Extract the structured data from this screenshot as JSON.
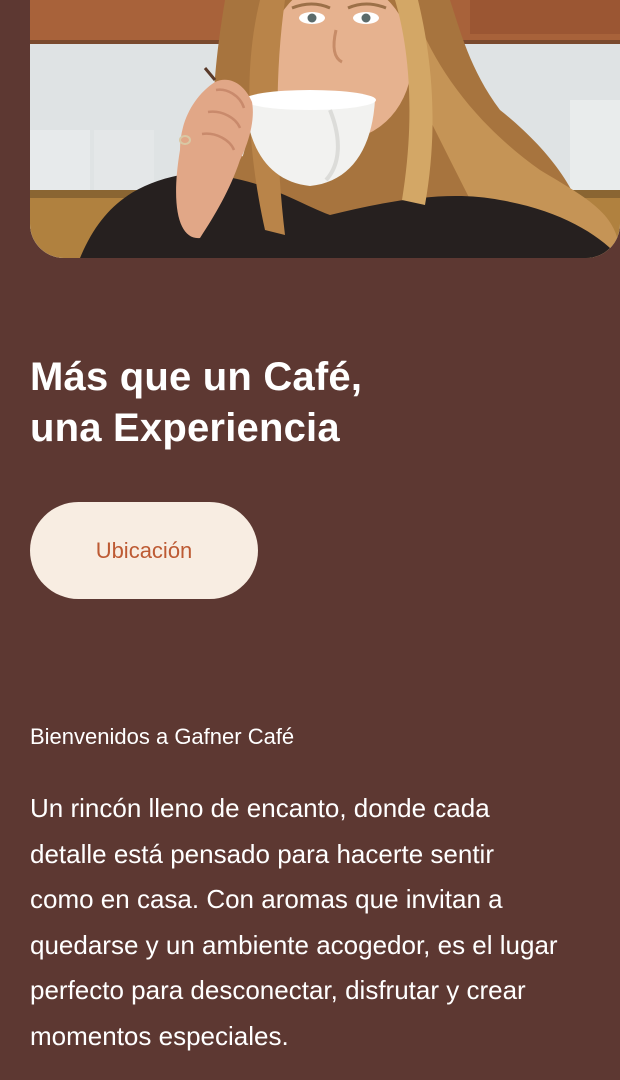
{
  "hero": {
    "image_alt": "Mujer bebiendo café de una taza blanca"
  },
  "headline": {
    "line1": "Más que un Café,",
    "line2": "una Experiencia"
  },
  "cta": {
    "label": "Ubicación"
  },
  "intro": {
    "welcome": "Bienvenidos a Gafner Café",
    "lines": [
      "Un rincón lleno de encanto, donde cada",
      "detalle está pensado para hacerte sentir",
      "como en casa. Con aromas que invitan a",
      "quedarse y un ambiente acogedor, es el lugar",
      "perfecto para desconectar, disfrutar y crear",
      "momentos especiales."
    ]
  },
  "colors": {
    "background": "#5d3832",
    "button_bg": "#f8ede2",
    "button_text": "#bd5a33",
    "text": "#ffffff"
  }
}
